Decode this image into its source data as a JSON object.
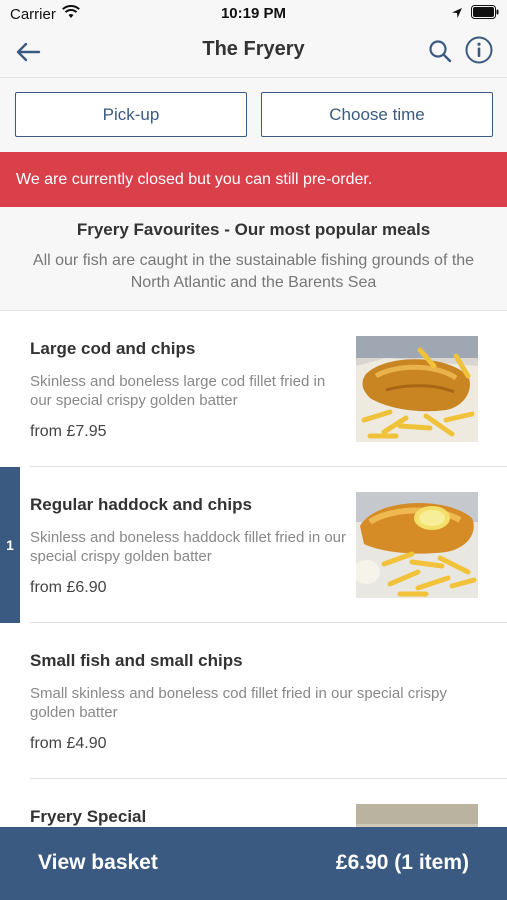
{
  "status_bar": {
    "carrier": "Carrier",
    "time": "10:19 PM",
    "icons": [
      "wifi-icon",
      "location-arrow-icon",
      "battery-icon"
    ]
  },
  "nav": {
    "title": "The Fryery",
    "icons": [
      "back-arrow-icon",
      "search-icon",
      "info-icon"
    ],
    "accent_color": "#3b5a82"
  },
  "options": {
    "pickup_label": "Pick-up",
    "time_label": "Choose time"
  },
  "banner": {
    "text": "We are currently closed but you can still pre-order.",
    "color": "#d9404a"
  },
  "section": {
    "title": "Fryery Favourites - Our most popular meals",
    "description": "All our fish are caught in the sustainable fishing grounds of the North Atlantic and the Barents Sea"
  },
  "menu": {
    "items": [
      {
        "name": "Large cod and chips",
        "description": "Skinless and boneless large cod fillet fried in our special crispy golden batter",
        "price": "from £7.95"
      },
      {
        "name": "Regular haddock and chips",
        "description": "Skinless and boneless haddock fillet fried in our special crispy golden batter",
        "price": "from £6.90",
        "quantity": "1"
      },
      {
        "name": "Small fish and small chips",
        "description": "Small skinless and boneless cod fillet fried in our special crispy golden batter",
        "price": "from £4.90"
      },
      {
        "name": "Fryery Special"
      }
    ]
  },
  "basket": {
    "label": "View basket",
    "total": "£6.90 (1 item)"
  }
}
